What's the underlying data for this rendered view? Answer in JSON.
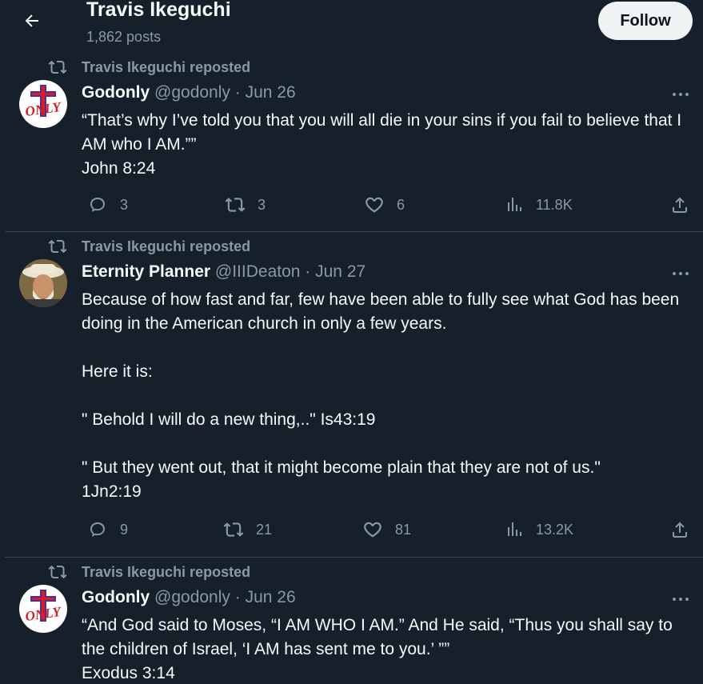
{
  "header": {
    "title": "Travis Ikeguchi",
    "posts_count": "1,862 posts",
    "follow_label": "Follow"
  },
  "colors": {
    "background": "#15202b",
    "text_primary": "#f7f9f9",
    "text_secondary": "#8b98a5",
    "divider": "#38444d",
    "follow_bg": "#eff3f4"
  },
  "posts": [
    {
      "repost_label": "Travis Ikeguchi reposted",
      "author_name": "Godonly",
      "author_handle": "@godonly",
      "date": "· Jun 26",
      "text": "“That’s why I’ve told you that you will all die in your sins if you fail to believe that I AM who I AM.””\nJohn 8:24",
      "replies": "3",
      "reposts": "3",
      "likes": "6",
      "views": "11.8K"
    },
    {
      "repost_label": "Travis Ikeguchi reposted",
      "author_name": "Eternity Planner",
      "author_handle": "@IIIDeaton",
      "date": "· Jun 27",
      "text": "Because of how fast and far, few have been able to fully see what God has been doing in the American church in only a few years.\n\nHere it is:\n\n\" Behold I will do a new thing,..\" Is43:19\n\n\" But they went out, that it might become plain that they are not of us.\"\n1Jn2:19",
      "replies": "9",
      "reposts": "21",
      "likes": "81",
      "views": "13.2K"
    },
    {
      "repost_label": "Travis Ikeguchi reposted",
      "author_name": "Godonly",
      "author_handle": "@godonly",
      "date": "· Jun 26",
      "text": "“And God said to Moses, “I AM WHO I AM.” And He said, “Thus you shall say to the children of Israel, ‘I AM has sent me to you.’ ””\nExodus 3:14"
    }
  ],
  "avatar_logo_text": "ONLY",
  "icons": {
    "back": "arrow-left-icon",
    "repost": "repost-icon",
    "more": "more-horizontal-icon",
    "reply": "reply-bubble-icon",
    "like": "heart-icon",
    "views": "bar-chart-icon",
    "share": "share-icon"
  }
}
